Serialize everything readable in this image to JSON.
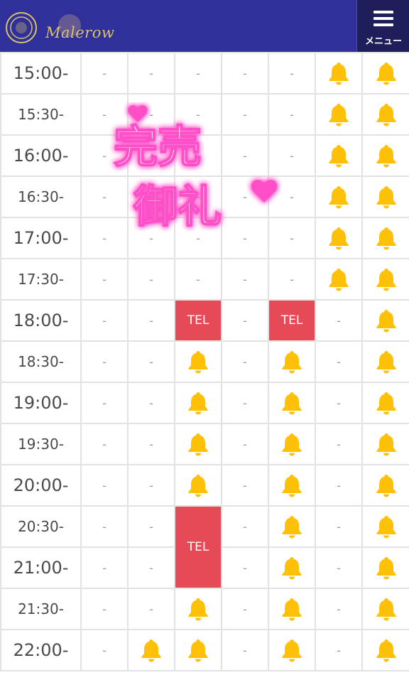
{
  "header": {
    "logo_text": "Malerow",
    "menu_label": "メニュー"
  },
  "sold_out_stamp": {
    "line1": "完売",
    "line2": "御礼"
  },
  "rows": [
    {
      "time": "15:00-",
      "cells": [
        "-",
        "-",
        "-",
        "-",
        "-",
        "bell",
        "bell"
      ]
    },
    {
      "time": "15:30-",
      "cells": [
        "-",
        "-",
        "-",
        "-",
        "-",
        "bell",
        "bell"
      ]
    },
    {
      "time": "16:00-",
      "cells": [
        "-",
        "-",
        "-",
        "-",
        "-",
        "bell",
        "bell"
      ]
    },
    {
      "time": "16:30-",
      "cells": [
        "-",
        "-",
        "-",
        "-",
        "-",
        "bell",
        "bell"
      ]
    },
    {
      "time": "17:00-",
      "cells": [
        "-",
        "-",
        "-",
        "-",
        "-",
        "bell",
        "bell"
      ]
    },
    {
      "time": "17:30-",
      "cells": [
        "-",
        "-",
        "-",
        "-",
        "-",
        "bell",
        "bell"
      ]
    },
    {
      "time": "18:00-",
      "cells": [
        "-",
        "-",
        "TEL",
        "-",
        "TEL",
        "-",
        "bell"
      ]
    },
    {
      "time": "18:30-",
      "cells": [
        "-",
        "-",
        "bell",
        "-",
        "bell",
        "-",
        "bell"
      ]
    },
    {
      "time": "19:00-",
      "cells": [
        "-",
        "-",
        "bell",
        "-",
        "bell",
        "-",
        "bell"
      ]
    },
    {
      "time": "19:30-",
      "cells": [
        "-",
        "-",
        "bell",
        "-",
        "bell",
        "-",
        "bell"
      ]
    },
    {
      "time": "20:00-",
      "cells": [
        "-",
        "-",
        "bell",
        "-",
        "bell",
        "-",
        "bell"
      ]
    },
    {
      "time": "20:30-",
      "cells": [
        "-",
        "-",
        "TEL2",
        "-",
        "bell",
        "-",
        "bell"
      ]
    },
    {
      "time": "21:00-",
      "cells": [
        "-",
        "-",
        "skip",
        "-",
        "bell",
        "-",
        "bell"
      ]
    },
    {
      "time": "21:30-",
      "cells": [
        "-",
        "-",
        "bell",
        "-",
        "bell",
        "-",
        "bell"
      ]
    },
    {
      "time": "22:00-",
      "cells": [
        "-",
        "bell",
        "bell",
        "-",
        "bell",
        "-",
        "bell"
      ]
    }
  ],
  "colors": {
    "header": "#30309a",
    "tel": "#e64a57",
    "bell": "#ffc107",
    "stamp": "#ff4fc8"
  }
}
